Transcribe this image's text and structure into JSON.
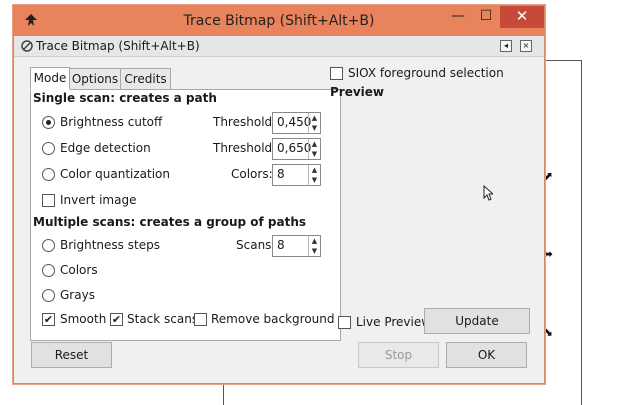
{
  "window": {
    "title": "Trace Bitmap (Shift+Alt+B)",
    "minimize_glyph": "—",
    "maximize_glyph": "☐",
    "close_glyph": "✕"
  },
  "dock": {
    "title": "Trace Bitmap (Shift+Alt+B)",
    "restore_glyph": "◂",
    "close_glyph": "×"
  },
  "tabs": [
    {
      "label": "Mode",
      "active": true
    },
    {
      "label": "Options",
      "active": false
    },
    {
      "label": "Credits",
      "active": false
    }
  ],
  "single_scan": {
    "heading": "Single scan: creates a path",
    "options": [
      {
        "label": "Brightness cutoff",
        "selected": true,
        "param_label": "Threshold:",
        "param_value": "0,450"
      },
      {
        "label": "Edge detection",
        "selected": false,
        "param_label": "Threshold:",
        "param_value": "0,650"
      },
      {
        "label": "Color quantization",
        "selected": false,
        "param_label": "Colors:",
        "param_value": "8"
      }
    ],
    "invert_image": {
      "label": "Invert image",
      "checked": false
    }
  },
  "multi_scan": {
    "heading": "Multiple scans: creates a group of paths",
    "options": [
      {
        "label": "Brightness steps",
        "selected": false,
        "param_label": "Scans:",
        "param_value": "8"
      },
      {
        "label": "Colors",
        "selected": false
      },
      {
        "label": "Grays",
        "selected": false
      }
    ],
    "checks": [
      {
        "label": "Smooth",
        "checked": true
      },
      {
        "label": "Stack scans",
        "checked": true
      },
      {
        "label": "Remove background",
        "checked": false
      }
    ]
  },
  "siox": {
    "label": "SIOX foreground selection",
    "checked": false
  },
  "preview": {
    "heading": "Preview",
    "live_label": "Live Preview",
    "live_checked": false,
    "update_label": "Update"
  },
  "buttons": {
    "reset": "Reset",
    "stop": "Stop",
    "ok": "OK"
  },
  "colors": {
    "titlebar": "#e9835c",
    "close": "#c7493a"
  }
}
